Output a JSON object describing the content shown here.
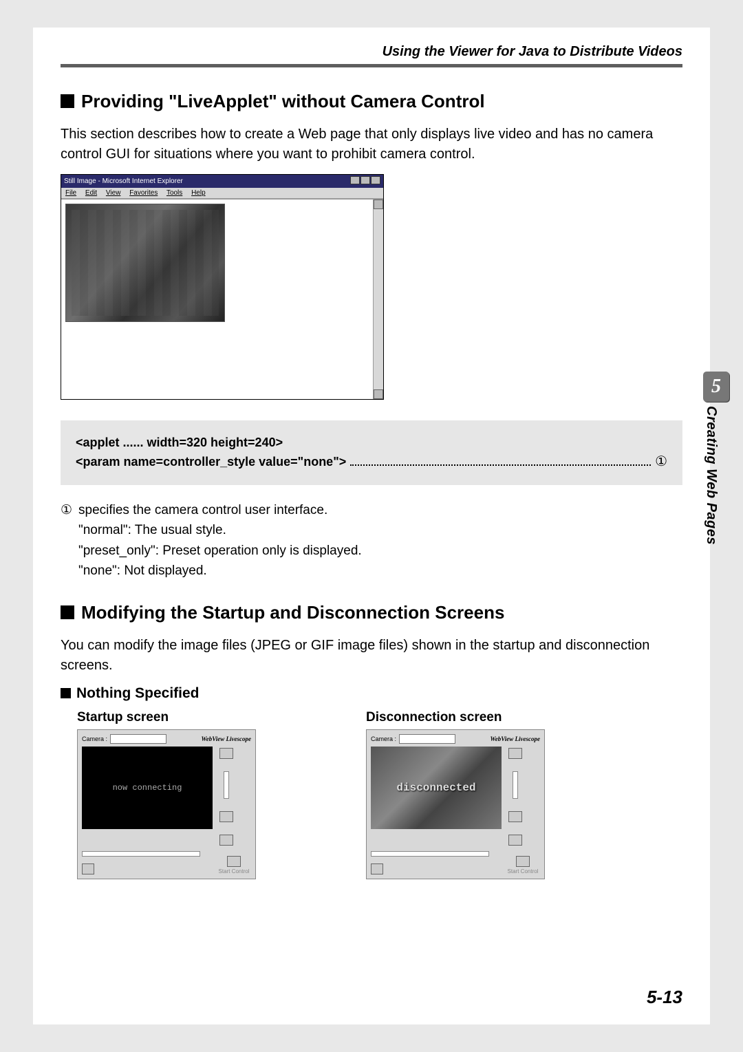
{
  "header": "Using the Viewer for Java to Distribute Videos",
  "section1": {
    "title": "Providing \"LiveApplet\" without Camera Control",
    "intro": "This section describes how to create a Web page that only displays live video and has no camera control GUI for situations where you want to prohibit camera control."
  },
  "browser": {
    "title": "Still Image - Microsoft Internet Explorer",
    "menu": {
      "file": "File",
      "edit": "Edit",
      "view": "View",
      "favorites": "Favorites",
      "tools": "Tools",
      "help": "Help"
    }
  },
  "code": {
    "line1": "<applet ...... width=320 height=240>",
    "line2": "<param name=controller_style value=\"none\">",
    "ref1": "①"
  },
  "desc": {
    "num": "①",
    "l1": "specifies the camera control user interface.",
    "l2": "\"normal\": The usual style.",
    "l3": "\"preset_only\": Preset operation only is displayed.",
    "l4": "\"none\": Not displayed."
  },
  "section2": {
    "title": "Modifying the Startup and Disconnection Screens",
    "intro": "You can modify the image files (JPEG or GIF image files) shown in the startup and disconnection screens."
  },
  "sub": {
    "nothing": "Nothing Specified",
    "startup": "Startup screen",
    "disconnect": "Disconnection screen"
  },
  "mini": {
    "camera_label": "Camera :",
    "logo": "WebView Livescope",
    "connecting": "now connecting",
    "disconnected": "disconnected",
    "start_control": "Start Control"
  },
  "tab": {
    "chapter_num": "5",
    "chapter_title": "Creating Web Pages"
  },
  "page_number": "5-13"
}
